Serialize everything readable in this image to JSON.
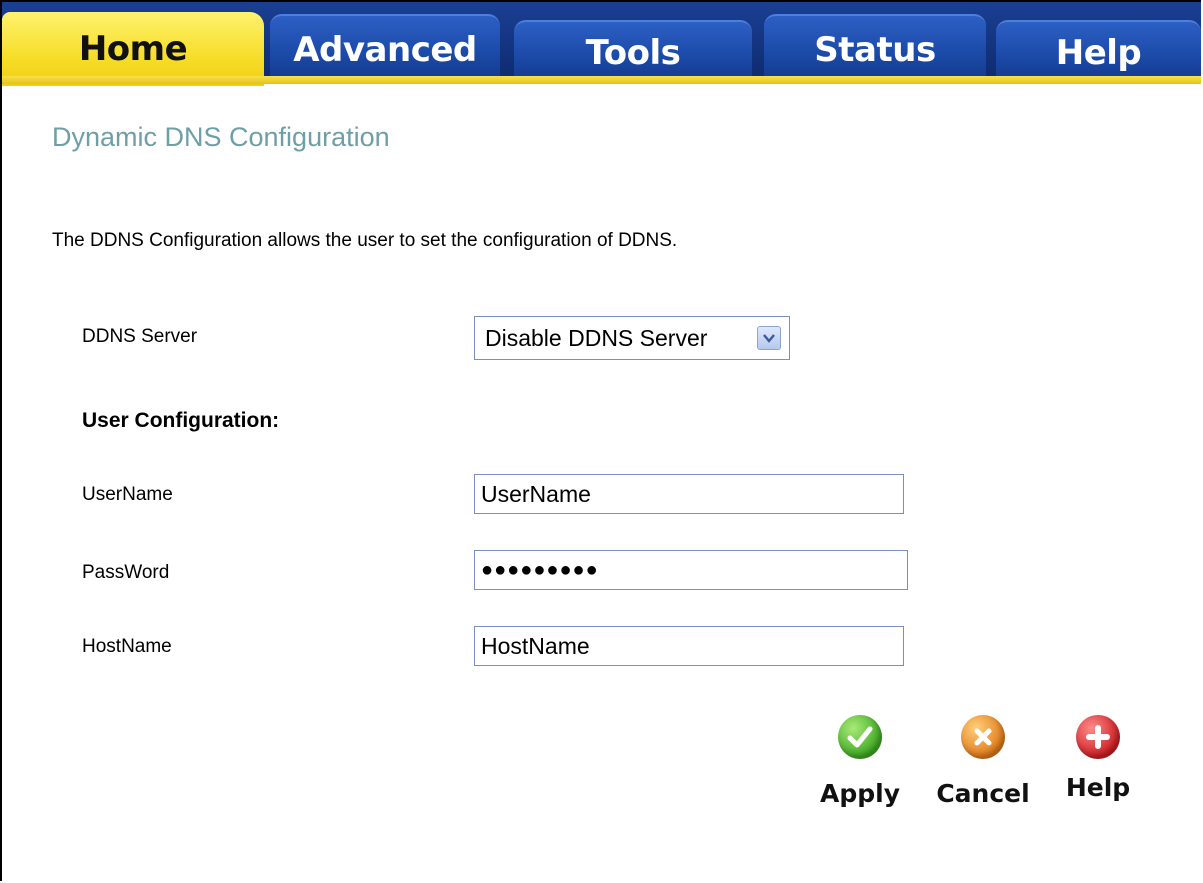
{
  "tabs": [
    {
      "label": "Home",
      "active": true
    },
    {
      "label": "Advanced",
      "active": false
    },
    {
      "label": "Tools",
      "active": false
    },
    {
      "label": "Status",
      "active": false
    },
    {
      "label": "Help",
      "active": false
    }
  ],
  "page": {
    "title": "Dynamic DNS Configuration",
    "description": "The DDNS Configuration allows the user to set the configuration of DDNS."
  },
  "ddns_server": {
    "label": "DDNS Server",
    "selected": "Disable DDNS Server"
  },
  "user_config": {
    "heading": "User Configuration:",
    "username": {
      "label": "UserName",
      "value": "UserName"
    },
    "password": {
      "label": "PassWord",
      "value": "●●●●●●●●●"
    },
    "hostname": {
      "label": "HostName",
      "value": "HostName"
    }
  },
  "actions": {
    "apply": "Apply",
    "cancel": "Cancel",
    "help": "Help"
  },
  "colors": {
    "tab_blue": "#1b4aa8",
    "tab_active": "#f7de2a",
    "title": "#6f9fa6"
  }
}
